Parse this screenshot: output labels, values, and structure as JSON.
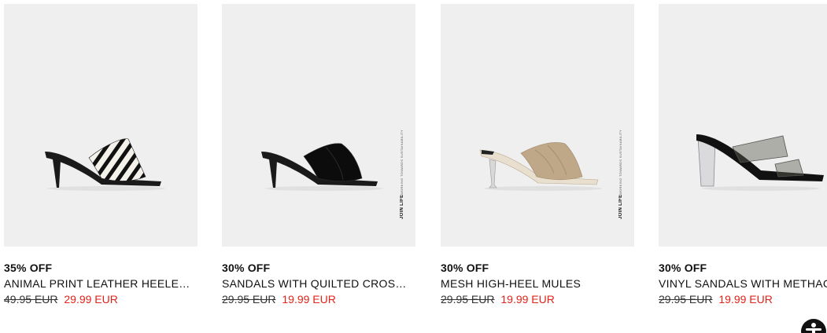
{
  "products": [
    {
      "discount": "35% OFF",
      "name": "ANIMAL PRINT LEATHER HEELED MULES",
      "old_price": "49.95 EUR",
      "new_price": "29.99 EUR",
      "image": "zebra-print-heeled-mule"
    },
    {
      "discount": "30% OFF",
      "name": "SANDALS WITH QUILTED CROSSED STRAPS",
      "old_price": "29.95 EUR",
      "new_price": "19.99 EUR",
      "image": "black-quilted-heeled-mule",
      "badge": "JOIN LIFE",
      "badge_sub": "WORKING TOWARDS SUSTAINABILITY"
    },
    {
      "discount": "30% OFF",
      "name": "MESH HIGH-HEEL MULES",
      "old_price": "29.95 EUR",
      "new_price": "19.99 EUR",
      "image": "beige-mesh-heeled-mule",
      "badge": "JOIN LIFE",
      "badge_sub": "WORKING TOWARDS SUSTAINABILITY"
    },
    {
      "discount": "30% OFF",
      "name": "VINYL SANDALS WITH METHACRYLATE HEEL",
      "old_price": "29.95 EUR",
      "new_price": "19.99 EUR",
      "image": "vinyl-clear-heel-sandal"
    }
  ],
  "colors": {
    "sale": "#e2231a",
    "photo_bg": "#efefef"
  },
  "accessibility_button": "accessibility-icon"
}
